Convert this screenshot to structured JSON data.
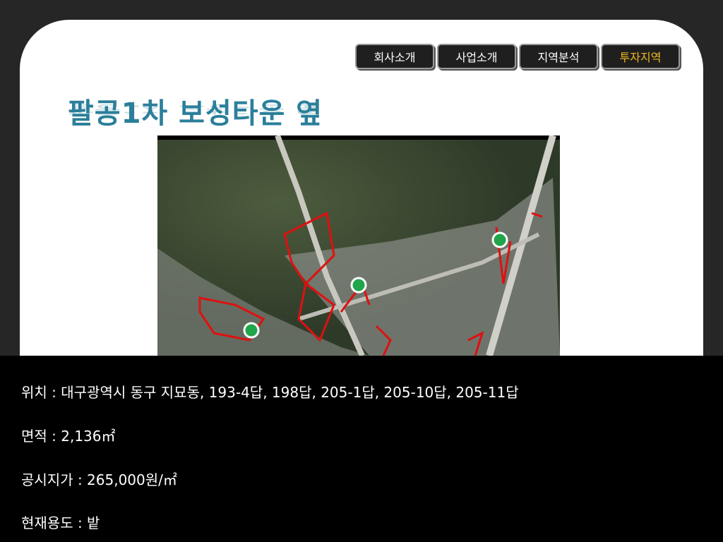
{
  "nav": {
    "items": [
      {
        "label": "회사소개",
        "active": false
      },
      {
        "label": "사업소개",
        "active": false
      },
      {
        "label": "지역분석",
        "active": false
      },
      {
        "label": "투자지역",
        "active": true
      }
    ],
    "active_color": "#f2b81c"
  },
  "page_title": "팔공1차 보성타운 옆",
  "details": {
    "location": "위치 : 대구광역시 동구 지묘동, 193-4답, 198답, 205-1답, 205-10답, 205-11답",
    "area": "면적 : 2,136㎡",
    "price": "공시지가 : 265,000원/㎡",
    "usage": "현재용도 : 밭"
  }
}
